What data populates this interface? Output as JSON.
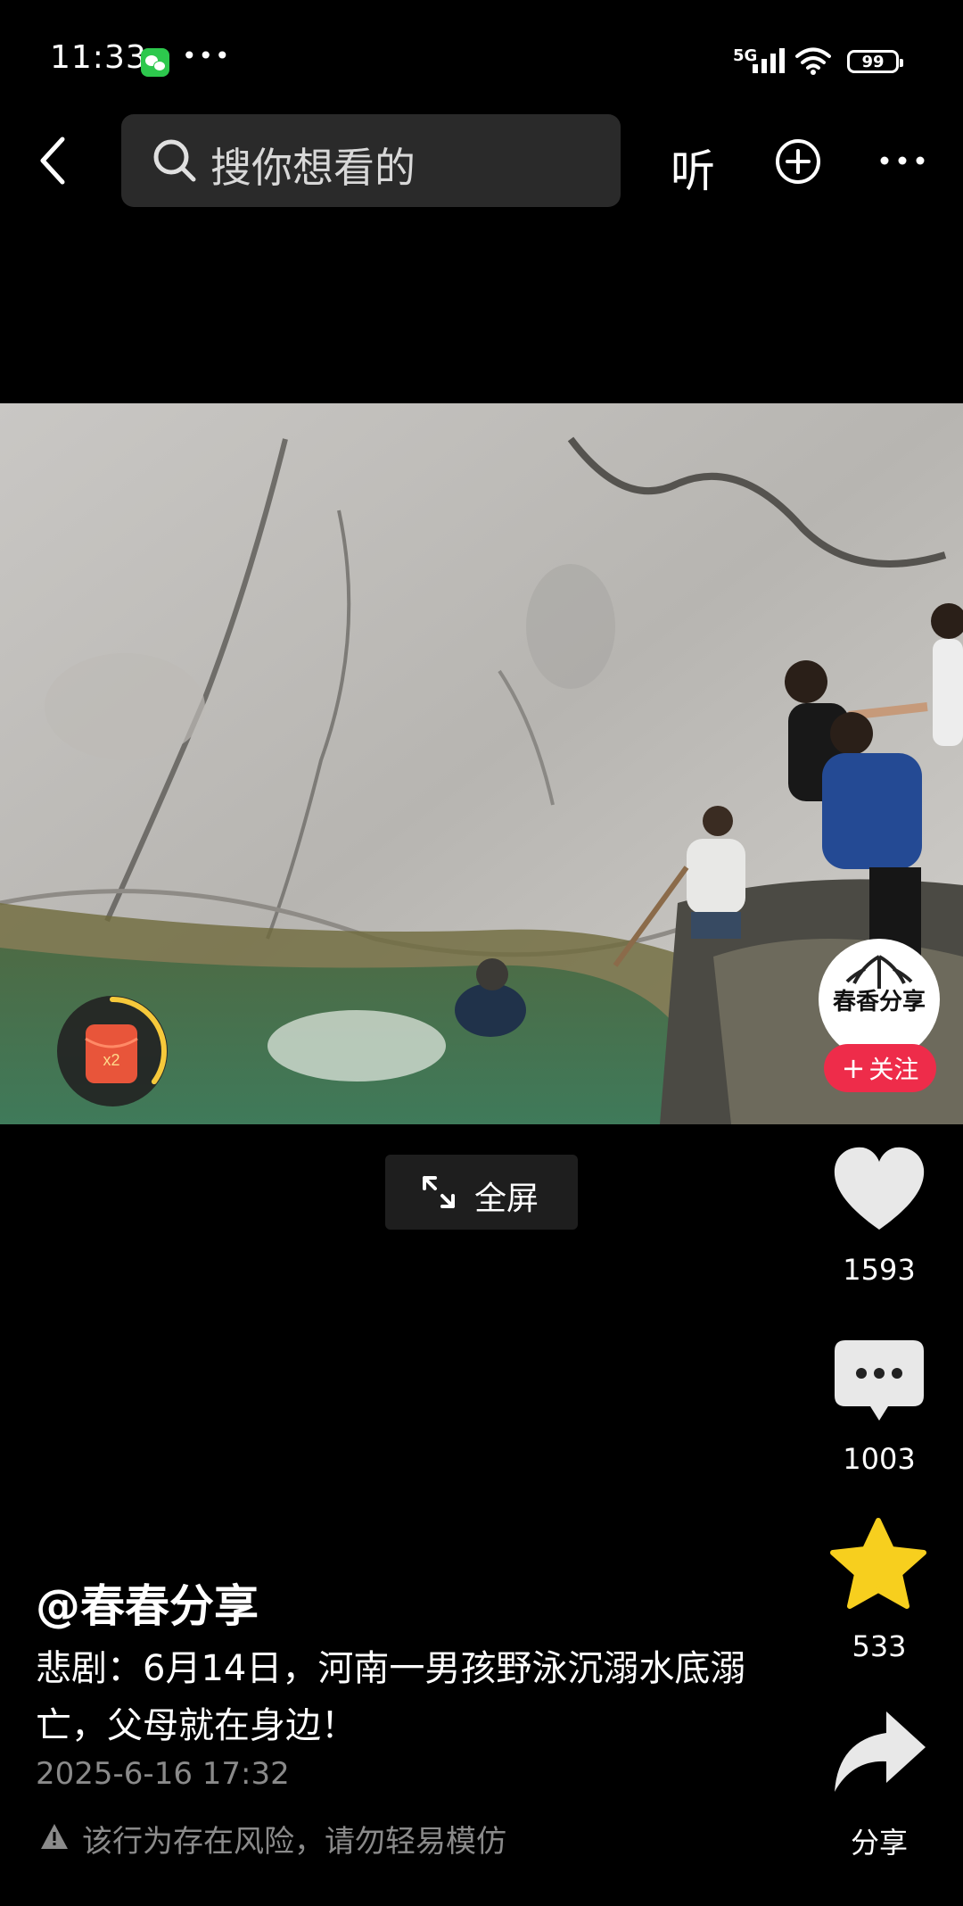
{
  "status_bar": {
    "time": "11:33",
    "network": "5G",
    "battery": "99",
    "icons": [
      "wechat-icon",
      "more-dots-icon",
      "signal-icon",
      "wifi-icon",
      "battery-icon"
    ]
  },
  "top_bar": {
    "search_placeholder": "搜你想看的",
    "listen_label": "听",
    "icons": [
      "back-icon",
      "search-icon",
      "add-circle-icon",
      "more-icon"
    ]
  },
  "video": {
    "fullscreen_label": "全屏",
    "follow_label": "关注",
    "follow_plus": "+",
    "avatar_text": "春香分享",
    "redpacket_label": "x2",
    "redpacket_progress": 0.35
  },
  "actions": {
    "likes": "1593",
    "comments": "1003",
    "favorites": "533",
    "share_label": "分享"
  },
  "post": {
    "author": "@春春分享",
    "description": "悲剧：6月14日，河南一男孩野泳沉溺水底溺亡，父母就在身边！",
    "date": "2025-6-16 17:32",
    "warning": "该行为存在风险，请勿轻易模仿"
  },
  "colors": {
    "background": "#000000",
    "follow": "#ee2c4a",
    "star": "#f7cf1e",
    "redpacket": "#e8553a"
  }
}
